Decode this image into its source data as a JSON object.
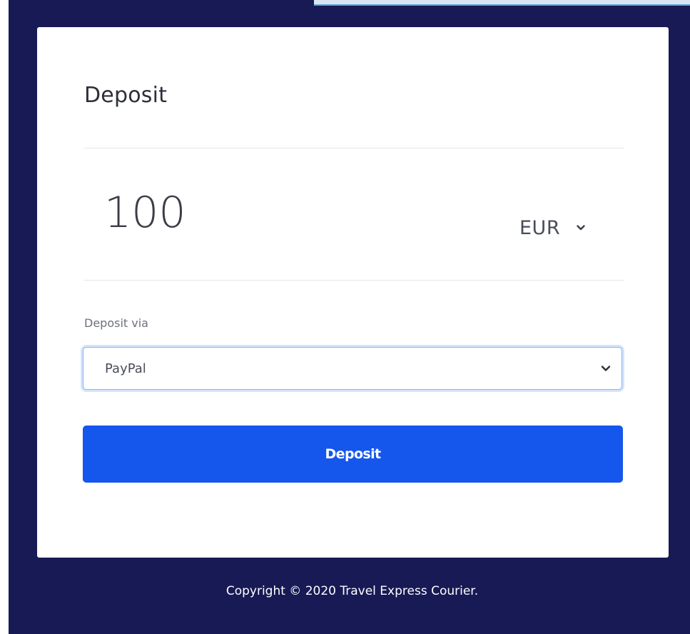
{
  "card": {
    "title": "Deposit"
  },
  "amount": {
    "value": "100",
    "currency": "EUR"
  },
  "deposit_via": {
    "label": "Deposit via",
    "selected": "PayPal"
  },
  "actions": {
    "deposit_label": "Deposit"
  },
  "footer": {
    "copyright": "Copyright © 2020 Travel Express Courier."
  },
  "colors": {
    "background": "#181a55",
    "primary_button": "#1556ec",
    "focus_border": "#86b3f5"
  },
  "icons": {
    "currency_dropdown": "chevron-down-icon",
    "via_dropdown": "chevron-down-icon"
  }
}
